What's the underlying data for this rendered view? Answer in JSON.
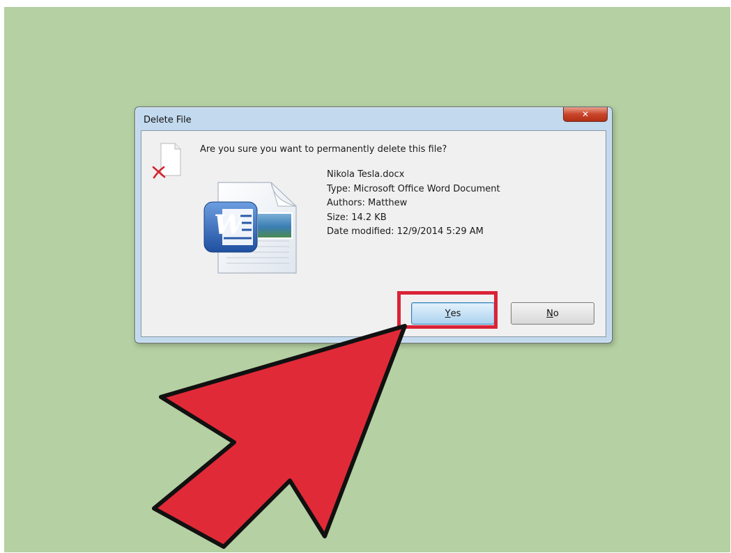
{
  "dialog": {
    "title": "Delete File",
    "close_glyph": "✕",
    "question": "Are you sure you want to permanently delete this file?",
    "file": {
      "name": "Nikola Tesla.docx",
      "type": "Type: Microsoft Office Word Document",
      "authors": "Authors: Matthew",
      "size": "Size: 14.2 KB",
      "modified": "Date modified: 12/9/2014 5:29 AM"
    },
    "yes_mnemonic": "Y",
    "yes_rest": "es",
    "no_mnemonic": "N",
    "no_rest": "o"
  },
  "icons": {
    "warning": "file-delete-icon",
    "document": "word-document-icon",
    "annotation_arrow": "pointer-arrow"
  },
  "colors": {
    "background": "#b5d0a2",
    "highlight": "#d92337",
    "arrow": "#e12a38"
  }
}
